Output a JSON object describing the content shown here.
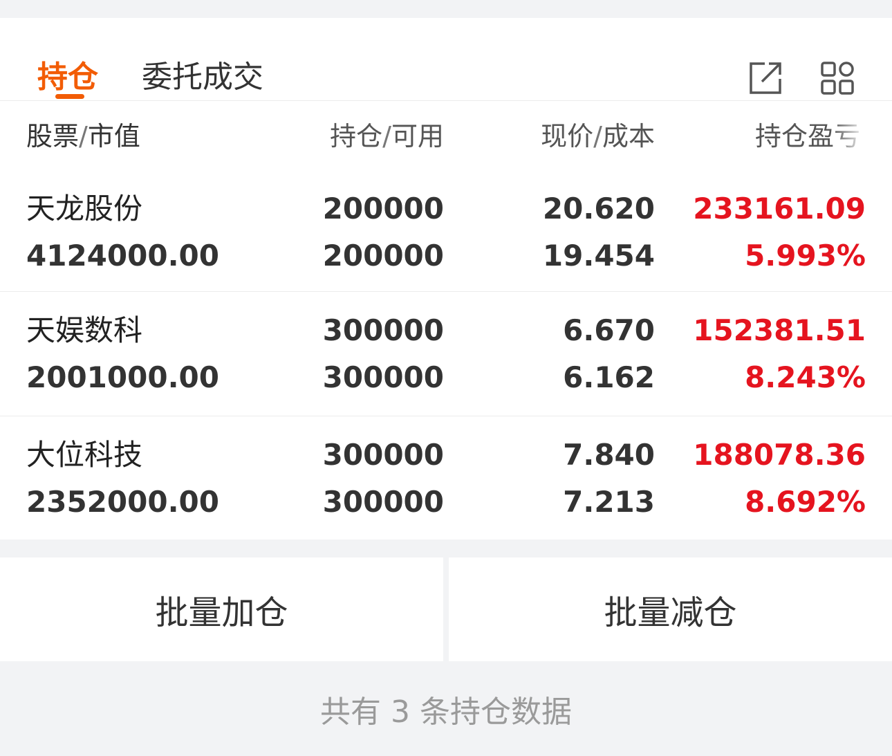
{
  "tabs": [
    {
      "label": "持仓",
      "active": true
    },
    {
      "label": "委托成交",
      "active": false
    }
  ],
  "icons": {
    "share": "share-external-icon",
    "grid": "grid-apps-icon"
  },
  "colors": {
    "accent": "#f25c05",
    "profit": "#e5141f"
  },
  "header": {
    "stock": "股票",
    "market_value": "市值",
    "position": "持仓",
    "available": "可用",
    "price": "现价",
    "cost": "成本",
    "pnl": "持仓盈亏"
  },
  "holdings": [
    {
      "name": "天龙股份",
      "market_value": "4124000.00",
      "position": "200000",
      "available": "200000",
      "price": "20.620",
      "cost": "19.454",
      "pnl": "233161.09",
      "pnl_pct": "5.993%"
    },
    {
      "name": "天娱数科",
      "market_value": "2001000.00",
      "position": "300000",
      "available": "300000",
      "price": "6.670",
      "cost": "6.162",
      "pnl": "152381.51",
      "pnl_pct": "8.243%"
    },
    {
      "name": "大位科技",
      "market_value": "2352000.00",
      "position": "300000",
      "available": "300000",
      "price": "7.840",
      "cost": "7.213",
      "pnl": "188078.36",
      "pnl_pct": "8.692%"
    }
  ],
  "actions": {
    "batch_add": "批量加仓",
    "batch_reduce": "批量减仓"
  },
  "footer": "共有 3 条持仓数据"
}
